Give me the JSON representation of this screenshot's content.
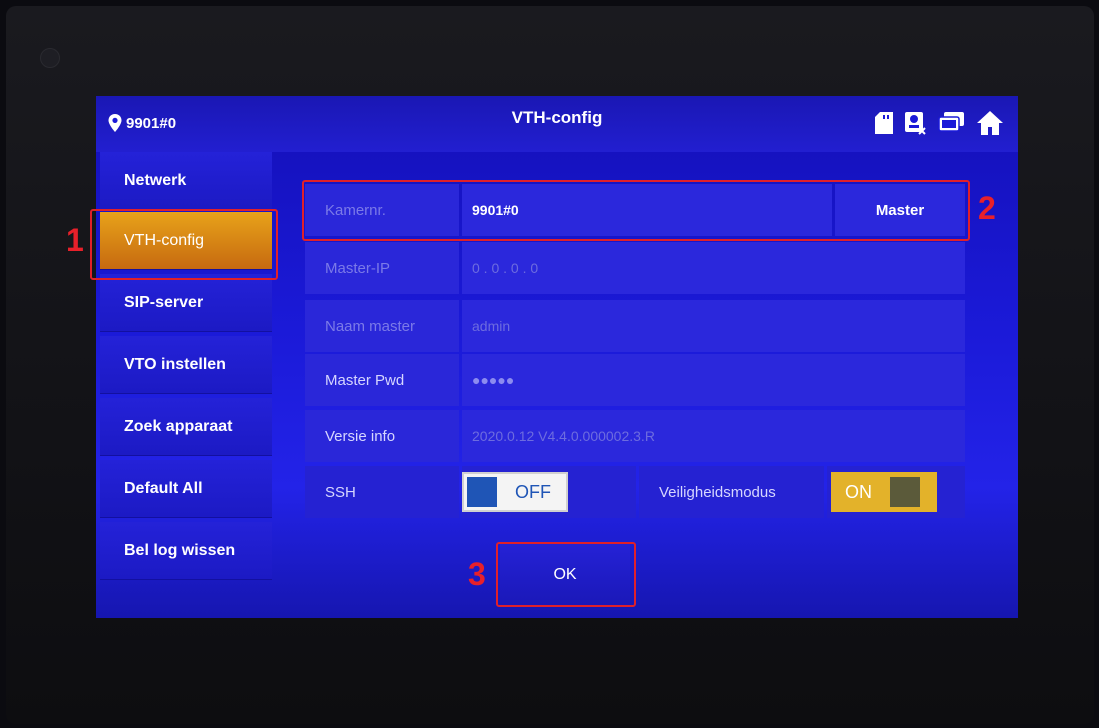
{
  "header": {
    "location": "9901#0",
    "title": "VTH-config"
  },
  "status_icons": [
    "sd-card-icon",
    "intercom-icon",
    "monitor-icon",
    "home-icon"
  ],
  "sidebar": {
    "items": [
      {
        "label": "Netwerk"
      },
      {
        "label": "VTH-config",
        "active": true
      },
      {
        "label": "SIP-server"
      },
      {
        "label": "VTO instellen"
      },
      {
        "label": "Zoek apparaat"
      },
      {
        "label": "Default All"
      },
      {
        "label": "Bel log wissen"
      }
    ]
  },
  "form": {
    "room": {
      "label": "Kamernr.",
      "value": "9901#0",
      "mode": "Master"
    },
    "master_ip": {
      "label": "Master-IP",
      "value": "0   .   0   .   0   .   0"
    },
    "master_name": {
      "label": "Naam master",
      "value": "admin"
    },
    "master_pwd": {
      "label": "Master Pwd",
      "value": "●●●●●"
    },
    "version": {
      "label": "Versie info",
      "value": "2020.0.12 V4.4.0.000002.3.R"
    },
    "ssh": {
      "label": "SSH",
      "state": "OFF"
    },
    "security": {
      "label": "Veiligheidsmodus",
      "state": "ON"
    }
  },
  "ok_label": "OK",
  "annotations": [
    "1",
    "2",
    "3"
  ],
  "colors": {
    "accent_active": "#e8a21a",
    "screen_blue": "#1b1ad8",
    "highlight": "#e0202a"
  }
}
